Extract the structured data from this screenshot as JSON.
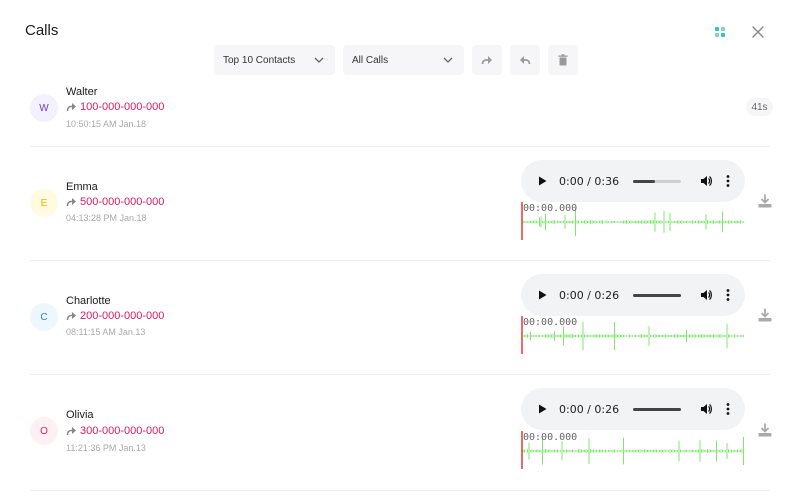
{
  "header": {
    "title": "Calls"
  },
  "toolbar": {
    "contacts_filter": "Top 10 Contacts",
    "calls_filter": "All Calls"
  },
  "calls": [
    {
      "initial": "W",
      "name": "Walter",
      "number": "100-000-000-000",
      "time": "10:50:15 AM Jan.18",
      "duration": "41s",
      "avatar_bg": "#f3f0ff",
      "avatar_fg": "#6c3ce0"
    },
    {
      "initial": "E",
      "name": "Emma",
      "number": "500-000-000-000",
      "time": "04:13:28 PM Jan.18",
      "player_time": "0:00 / 0:36",
      "progress": 0.45,
      "wave_time": "00:00.000",
      "avatar_bg": "#fffae0",
      "avatar_fg": "#e0b800"
    },
    {
      "initial": "C",
      "name": "Charlotte",
      "number": "200-000-000-000",
      "time": "08:11:15 AM Jan.13",
      "player_time": "0:00 / 0:26",
      "progress": 1.0,
      "wave_time": "00:00.000",
      "avatar_bg": "#eef6ff",
      "avatar_fg": "#1e88e5"
    },
    {
      "initial": "O",
      "name": "Olivia",
      "number": "300-000-000-000",
      "time": "11:21:36 PM Jan.13",
      "player_time": "0:00 / 0:26",
      "progress": 1.0,
      "wave_time": "00:00.000",
      "avatar_bg": "#fff1f3",
      "avatar_fg": "#d81b60"
    }
  ],
  "colors": {
    "number": "#d81b60",
    "waveform": "#7ee86b",
    "cursor": "#e53935",
    "accent": "#34c6b0"
  },
  "icons": {
    "apps": "grid-dots-icon",
    "close": "close-icon",
    "forward": "forward-arrow-icon",
    "reply": "reply-arrow-icon",
    "delete": "trash-icon",
    "download": "download-icon"
  }
}
